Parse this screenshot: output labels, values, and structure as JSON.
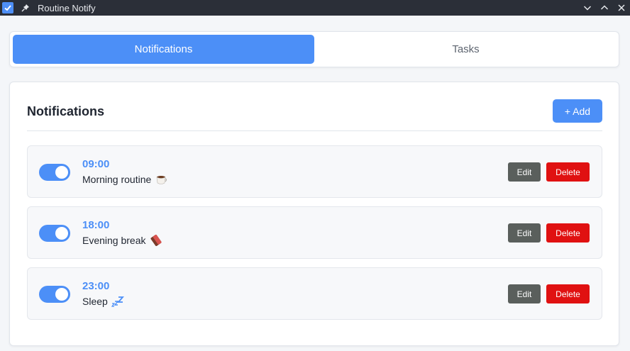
{
  "window": {
    "title": "Routine Notify",
    "icons": [
      "checkbox-icon",
      "pin-icon",
      "chevron-down-icon",
      "chevron-up-icon",
      "close-icon"
    ]
  },
  "tabs": [
    {
      "label": "Notifications",
      "active": true
    },
    {
      "label": "Tasks",
      "active": false
    }
  ],
  "section": {
    "title": "Notifications",
    "add_label": "+ Add"
  },
  "notifications": [
    {
      "time": "09:00",
      "label": "Morning routine",
      "emoji": "coffee-icon",
      "enabled": true,
      "edit_label": "Edit",
      "delete_label": "Delete"
    },
    {
      "time": "18:00",
      "label": "Evening break",
      "emoji": "chocolate-icon",
      "enabled": true,
      "edit_label": "Edit",
      "delete_label": "Delete"
    },
    {
      "time": "23:00",
      "label": "Sleep",
      "emoji": "zzz-icon",
      "enabled": true,
      "edit_label": "Edit",
      "delete_label": "Delete"
    }
  ],
  "colors": {
    "accent": "#4c8ff7",
    "delete": "#e01111",
    "edit": "#5a5f5c",
    "titlebar": "#2b2f38"
  }
}
